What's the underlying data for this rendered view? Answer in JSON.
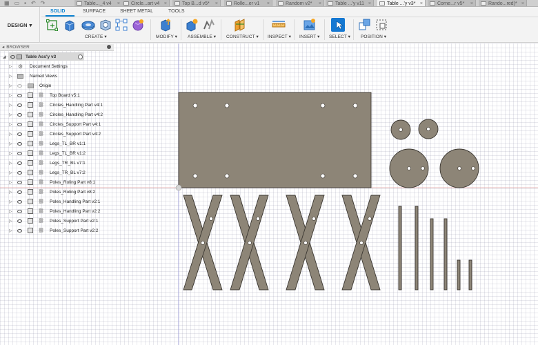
{
  "tabs": [
    {
      "label": "Table..._4 v4",
      "active": false
    },
    {
      "label": "Circle...art v4",
      "active": false
    },
    {
      "label": "Top B...d v5*",
      "active": false
    },
    {
      "label": "Rolle...er v1",
      "active": false
    },
    {
      "label": "Random v2*",
      "active": false
    },
    {
      "label": "Table ...'y v11",
      "active": false
    },
    {
      "label": "Table ...'y v3*",
      "active": true
    },
    {
      "label": "Corne...r v5*",
      "active": false
    },
    {
      "label": "Rando...red)*",
      "active": false
    }
  ],
  "toolbar": {
    "design_label": "DESIGN",
    "workspace_tabs": [
      "SOLID",
      "SURFACE",
      "SHEET METAL",
      "TOOLS"
    ],
    "active_workspace": "SOLID",
    "groups": [
      "CREATE ▾",
      "MODIFY ▾",
      "ASSEMBLE ▾",
      "CONSTRUCT ▾",
      "INSPECT ▾",
      "INSERT ▾",
      "SELECT ▾",
      "POSITION ▾"
    ]
  },
  "browser": {
    "title": "BROWSER",
    "root": "Table Ass'y v3",
    "items": [
      {
        "label": "Document Settings",
        "type": "settings"
      },
      {
        "label": "Named Views",
        "type": "folder"
      },
      {
        "label": "Origin",
        "type": "folder"
      },
      {
        "label": "Top Board v5:1",
        "type": "component"
      },
      {
        "label": "Circles_Handling Part v4:1",
        "type": "component"
      },
      {
        "label": "Circles_Handling Part v4:2",
        "type": "component"
      },
      {
        "label": "Circles_Support Part v4:1",
        "type": "component"
      },
      {
        "label": "Circles_Support Part v4:2",
        "type": "component"
      },
      {
        "label": "Legs_TL_BR v1:1",
        "type": "component"
      },
      {
        "label": "Legs_TL_BR v1:2",
        "type": "component"
      },
      {
        "label": "Legs_TR_BL v7:1",
        "type": "component"
      },
      {
        "label": "Legs_TR_BL v7:2",
        "type": "component"
      },
      {
        "label": "Poles_Roling Part v8:1",
        "type": "component"
      },
      {
        "label": "Poles_Roling Part v8:2",
        "type": "component"
      },
      {
        "label": "Poles_Handling Part v2:1",
        "type": "component"
      },
      {
        "label": "Poles_Handling Part v2:2",
        "type": "component"
      },
      {
        "label": "Poles_Support Part v2:1",
        "type": "component"
      },
      {
        "label": "Poles_Support Part v2:2",
        "type": "component"
      }
    ]
  },
  "colors": {
    "accent": "#0b82d1",
    "part_fill": "#8d8577",
    "part_stroke": "#3a3630"
  }
}
